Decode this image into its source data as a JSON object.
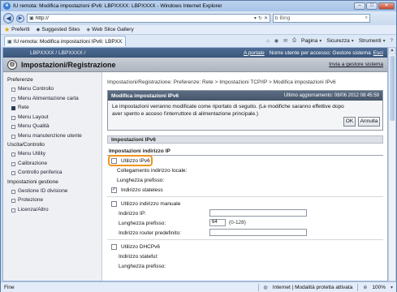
{
  "window": {
    "title": "IU remota: Modifica impostazioni IPv6: LBPXXXX: LBPXXXX - Windows Internet Explorer",
    "minimize": "–",
    "maximize": "□",
    "close": "✕"
  },
  "address": {
    "url": "http://",
    "search_placeholder": "Bing",
    "back": "◀",
    "forward": "▶"
  },
  "favorites": {
    "label": "Preferiti",
    "suggested_sites": "Suggested Sites",
    "web_slice_gallery": "Web Slice Gallery"
  },
  "tab": {
    "label": "IU remota: Modifica impostazioni IPv6: LBPXXXX: ..."
  },
  "command_bar": {
    "page": "Pagina",
    "security": "Sicurezza",
    "tools": "Strumenti"
  },
  "page": {
    "printer_name": "LBPXXXX / LBPXXXX /",
    "portal_link": "A portale",
    "user_info": "Nome utente per accesso: Gestore sistema",
    "logout": "Esci",
    "header_title": "Impostazioni/Registrazione",
    "back_to_admin": "Invia a gestore sistema"
  },
  "sidebar": {
    "groups": [
      {
        "title": "Preferenze",
        "items": [
          {
            "label": "Menu Controllo",
            "active": false
          },
          {
            "label": "Menu Alimentazione carta",
            "active": false
          },
          {
            "label": "Rete",
            "active": true
          },
          {
            "label": "Menu Layout",
            "active": false
          },
          {
            "label": "Menu Qualità",
            "active": false
          },
          {
            "label": "Menu manutenzione utente",
            "active": false
          }
        ]
      },
      {
        "title": "Uscita/Controllo",
        "items": [
          {
            "label": "Menu Utility",
            "active": false
          },
          {
            "label": "Calibrazione",
            "active": false
          },
          {
            "label": "Controllo periferica",
            "active": false
          }
        ]
      },
      {
        "title": "Impostazioni gestione",
        "items": [
          {
            "label": "Gestione ID divisione",
            "active": false
          },
          {
            "label": "Protezione",
            "active": false
          },
          {
            "label": "Licenza/Altro",
            "active": false
          }
        ]
      }
    ]
  },
  "main": {
    "breadcrumb": "Impostazioni/Registrazione: Preferenze: Rete > Impostazioni TCP/IP > Modifica impostazioni IPv6",
    "panel": {
      "title": "Modifica impostazioni IPv6",
      "last_updated": "Ultimo aggiornamento: 08/06 2012 08:45:59",
      "message": "Le impostazioni verranno modificate come riportato di seguito. (Le modifiche saranno effettive dopo aver spento e acceso l'interruttore di alimentazione principale.)",
      "ok_label": "OK",
      "cancel_label": "Annulla"
    },
    "section_title": "Impostazioni IPv6",
    "subsection_title": "Impostazioni indirizzo IP",
    "use_ipv6_label": "Utilizzo IPv6",
    "use_ipv6_checked": false,
    "link_local_label": "Collegamento indirizzo locale:",
    "prefix_length_label_1": "Lunghezza prefisso:",
    "stateless_label": "Indirizzo stateless",
    "stateless_checked": true,
    "manual_label": "Utilizzo indirizzo manuale",
    "manual_checked": false,
    "ip_address_label": "Indirizzo IP:",
    "ip_address_value": "",
    "prefix_length_label_2": "Lunghezza prefisso:",
    "prefix_length_value": "64",
    "prefix_hint": "(0-128)",
    "default_router_label": "Indirizzo router predefinito:",
    "default_router_value": "",
    "dhcpv6_label": "Utilizzo DHCPv6",
    "dhcpv6_checked": false,
    "stateful_label": "Indirizzo stateful:",
    "prefix_length_label_3": "Lunghezza prefisso:"
  },
  "status": {
    "text": "Fine",
    "zone": "Internet | Modalità protetta attivata",
    "zoom": "100%"
  }
}
